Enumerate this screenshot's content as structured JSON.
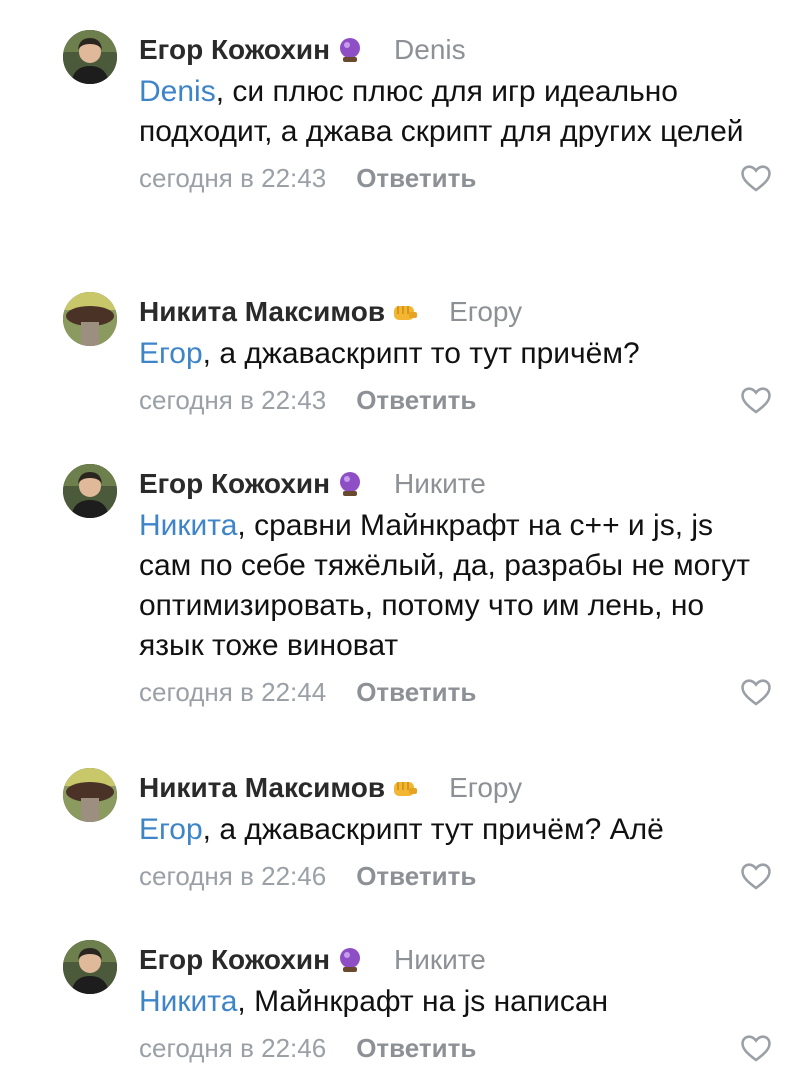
{
  "comments": [
    {
      "author": "Егор Кожохин",
      "badge": "crystal-ball-icon",
      "reply_to": "Denis",
      "mention": "Denis",
      "text": ", си плюс плюс для игр идеально подходит, а джава скрипт для других целей",
      "time": "сегодня в 22:43",
      "reply_label": "Ответить"
    },
    {
      "author": "Никита Максимов",
      "badge": "fist-icon",
      "reply_to": "Егору",
      "mention": "Егор",
      "text": ", а джаваскрипт то тут причём?",
      "time": "сегодня в 22:43",
      "reply_label": "Ответить"
    },
    {
      "author": "Егор Кожохин",
      "badge": "crystal-ball-icon",
      "reply_to": "Никите",
      "mention": "Никита",
      "text": ", сравни Майнкрафт на с++ и js, js сам по себе тяжёлый, да, разрабы не могут оптимизировать, потому что им лень, но язык тоже виноват",
      "time": "сегодня в 22:44",
      "reply_label": "Ответить"
    },
    {
      "author": "Никита Максимов",
      "badge": "fist-icon",
      "reply_to": "Егору",
      "mention": "Егор",
      "text": ", а джаваскрипт тут причём? Алё",
      "time": "сегодня в 22:46",
      "reply_label": "Ответить"
    },
    {
      "author": "Егор Кожохин",
      "badge": "crystal-ball-icon",
      "reply_to": "Никите",
      "mention": "Никита",
      "text": ", Майнкрафт на js написан",
      "time": "сегодня в 22:46",
      "reply_label": "Ответить"
    }
  ],
  "colors": {
    "mention": "#3e84c9",
    "secondary": "#8d9196",
    "text": "#111111"
  }
}
